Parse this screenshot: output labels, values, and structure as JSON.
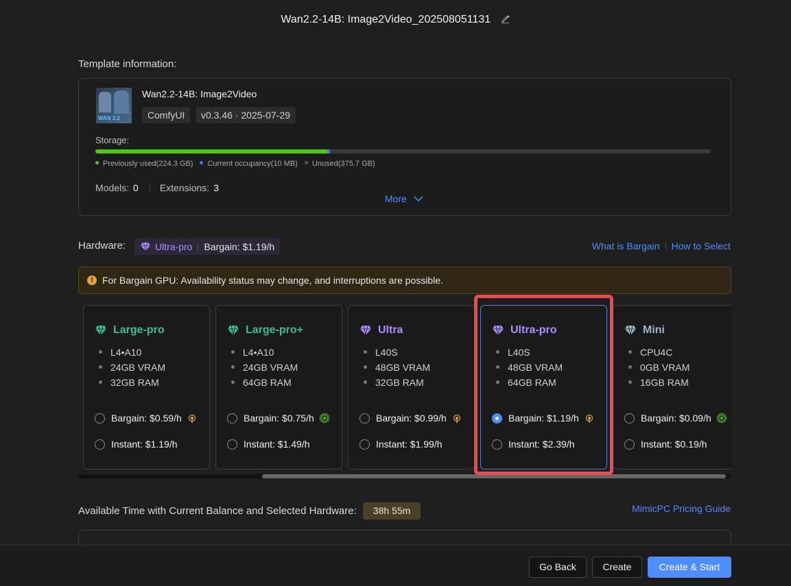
{
  "title": "Wan2.2-14B: Image2Video_202508051131",
  "template_section": {
    "label": "Template information:",
    "name": "Wan2.2-14B: Image2Video",
    "thumbnail_text": "WAN 2.2",
    "tags": [
      "ComfyUI",
      "v0.3.46 · 2025-07-29"
    ],
    "storage_label": "Storage:",
    "storage_used_fraction": 0.377,
    "legend": {
      "previously_used": "Previously used(224.3 GB)",
      "current": "Current occupancy(10 MB)",
      "unused": "Unused(375.7 GB)"
    },
    "models_label": "Models:",
    "models_value": "0",
    "extensions_label": "Extensions:",
    "extensions_value": "3",
    "more": "More"
  },
  "hardware": {
    "label": "Hardware:",
    "selected_tier": "Ultra-pro",
    "selected_price": "Bargain: $1.19/h",
    "link_bargain": "What is Bargain",
    "link_select": "How to Select",
    "warning": "For Bargain GPU: Availability status may change, and interruptions are possible.",
    "cards": [
      {
        "name": "Large-pro",
        "color": "#3fbf8f",
        "gpu": "L4•A10",
        "vram": "24GB VRAM",
        "ram": "32GB RAM",
        "bargain": "Bargain: $0.59/h",
        "instant": "Instant: $1.19/h",
        "signal": "orange",
        "selected": false
      },
      {
        "name": "Large-pro+",
        "color": "#3fbf8f",
        "gpu": "L4•A10",
        "vram": "24GB VRAM",
        "ram": "64GB RAM",
        "bargain": "Bargain: $0.75/h",
        "instant": "Instant: $1.49/h",
        "signal": "green",
        "selected": false
      },
      {
        "name": "Ultra",
        "color": "#b18cff",
        "gpu": "L40S",
        "vram": "48GB VRAM",
        "ram": "32GB RAM",
        "bargain": "Bargain: $0.99/h",
        "instant": "Instant: $1.99/h",
        "signal": "orange",
        "selected": false
      },
      {
        "name": "Ultra-pro",
        "color": "#b18cff",
        "gpu": "L40S",
        "vram": "48GB VRAM",
        "ram": "64GB RAM",
        "bargain": "Bargain: $1.19/h",
        "instant": "Instant: $2.39/h",
        "signal": "orange",
        "selected": true
      },
      {
        "name": "Mini",
        "color": "#9fb3c8",
        "gpu": "CPU4C",
        "vram": "0GB VRAM",
        "ram": "16GB RAM",
        "bargain": "Bargain: $0.09/h",
        "instant": "Instant: $0.19/h",
        "signal": "green",
        "selected": false
      }
    ]
  },
  "availability": {
    "label": "Available Time with Current Balance and Selected Hardware:",
    "time": "38h 55m",
    "guide": "MimicPC Pricing Guide"
  },
  "footer": {
    "go_back": "Go Back",
    "create": "Create",
    "create_start": "Create & Start"
  },
  "colors": {
    "accent": "#4d8dff",
    "highlight": "#ea4b4b",
    "signal_orange": "#e6a23c",
    "signal_green": "#52c41a"
  }
}
